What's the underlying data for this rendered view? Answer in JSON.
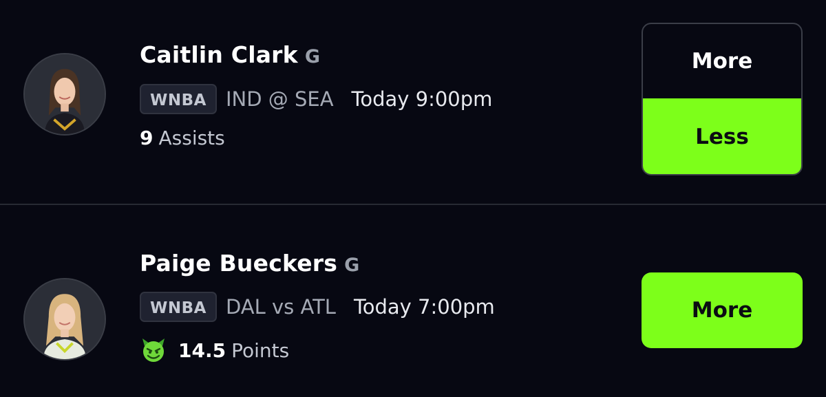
{
  "projections": [
    {
      "player": "Caitlin Clark",
      "position": "G",
      "league": "WNBA",
      "matchup": "IND @ SEA",
      "time": "Today 9:00pm",
      "line_value": "9",
      "stat": "Assists",
      "options": [
        "More",
        "Less"
      ],
      "selected": "Less"
    },
    {
      "player": "Paige Bueckers",
      "position": "G",
      "league": "WNBA",
      "matchup": "DAL vs ATL",
      "time": "Today 7:00pm",
      "line_value": "14.5",
      "stat": "Points",
      "stat_icon": "demon-icon",
      "options": [
        "More"
      ],
      "selected": "More"
    }
  ],
  "colors": {
    "background": "#070812",
    "accent": "#7dff1a",
    "divider": "#272a33"
  }
}
